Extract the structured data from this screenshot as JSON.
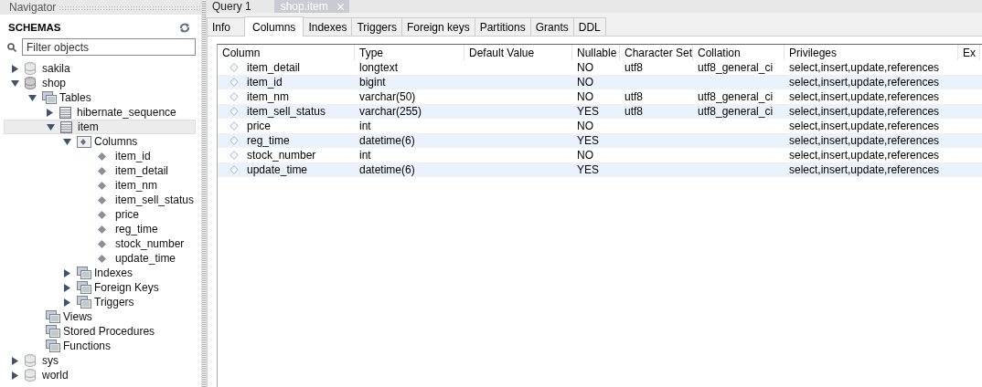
{
  "navigator": {
    "title": "Navigator",
    "section": "SCHEMAS",
    "filter": {
      "placeholder": "Filter objects"
    },
    "tree": [
      {
        "label": "sakila",
        "kind": "schema",
        "expanded": false,
        "selected": false
      },
      {
        "label": "shop",
        "kind": "schema",
        "expanded": true,
        "selected": false,
        "children": [
          {
            "label": "Tables",
            "kind": "group",
            "expanded": true,
            "selected": false,
            "children": [
              {
                "label": "hibernate_sequence",
                "kind": "table",
                "expanded": false,
                "selected": false
              },
              {
                "label": "item",
                "kind": "table",
                "expanded": true,
                "selected": true,
                "children": [
                  {
                    "label": "Columns",
                    "kind": "columns",
                    "expanded": true,
                    "selected": false,
                    "children": [
                      {
                        "label": "item_id",
                        "kind": "column",
                        "selected": false
                      },
                      {
                        "label": "item_detail",
                        "kind": "column",
                        "selected": false
                      },
                      {
                        "label": "item_nm",
                        "kind": "column",
                        "selected": false
                      },
                      {
                        "label": "item_sell_status",
                        "kind": "column",
                        "selected": false
                      },
                      {
                        "label": "price",
                        "kind": "column",
                        "selected": false
                      },
                      {
                        "label": "reg_time",
                        "kind": "column",
                        "selected": false
                      },
                      {
                        "label": "stock_number",
                        "kind": "column",
                        "selected": false
                      },
                      {
                        "label": "update_time",
                        "kind": "column",
                        "selected": false
                      }
                    ]
                  },
                  {
                    "label": "Indexes",
                    "kind": "group",
                    "expanded": false,
                    "selected": false
                  },
                  {
                    "label": "Foreign Keys",
                    "kind": "group",
                    "expanded": false,
                    "selected": false
                  },
                  {
                    "label": "Triggers",
                    "kind": "group",
                    "expanded": false,
                    "selected": false
                  }
                ]
              }
            ]
          },
          {
            "label": "Views",
            "kind": "group",
            "selected": false
          },
          {
            "label": "Stored Procedures",
            "kind": "group",
            "selected": false
          },
          {
            "label": "Functions",
            "kind": "group",
            "selected": false
          }
        ]
      },
      {
        "label": "sys",
        "kind": "schema",
        "expanded": false,
        "selected": false
      },
      {
        "label": "world",
        "kind": "schema",
        "expanded": false,
        "selected": false
      }
    ]
  },
  "editor_tabs": [
    {
      "label": "Query 1",
      "selected": false
    },
    {
      "label": "shop.item",
      "selected": true
    }
  ],
  "inspector_tabs": [
    {
      "label": "Info",
      "selected": false
    },
    {
      "label": "Columns",
      "selected": true
    },
    {
      "label": "Indexes",
      "selected": false
    },
    {
      "label": "Triggers",
      "selected": false
    },
    {
      "label": "Foreign keys",
      "selected": false
    },
    {
      "label": "Partitions",
      "selected": false
    },
    {
      "label": "Grants",
      "selected": false
    },
    {
      "label": "DDL",
      "selected": false
    }
  ],
  "table": {
    "columns": [
      "Column",
      "Type",
      "Default Value",
      "Nullable",
      "Character Set",
      "Collation",
      "Privileges",
      "Ex"
    ],
    "rows": [
      [
        "item_detail",
        "longtext",
        "",
        "NO",
        "utf8",
        "utf8_general_ci",
        "select,insert,update,references"
      ],
      [
        "item_id",
        "bigint",
        "",
        "NO",
        "",
        "",
        "select,insert,update,references"
      ],
      [
        "item_nm",
        "varchar(50)",
        "",
        "NO",
        "utf8",
        "utf8_general_ci",
        "select,insert,update,references"
      ],
      [
        "item_sell_status",
        "varchar(255)",
        "",
        "YES",
        "utf8",
        "utf8_general_ci",
        "select,insert,update,references"
      ],
      [
        "price",
        "int",
        "",
        "NO",
        "",
        "",
        "select,insert,update,references"
      ],
      [
        "reg_time",
        "datetime(6)",
        "",
        "YES",
        "",
        "",
        "select,insert,update,references"
      ],
      [
        "stock_number",
        "int",
        "",
        "NO",
        "",
        "",
        "select,insert,update,references"
      ],
      [
        "update_time",
        "datetime(6)",
        "",
        "YES",
        "",
        "",
        "select,insert,update,references"
      ]
    ]
  }
}
